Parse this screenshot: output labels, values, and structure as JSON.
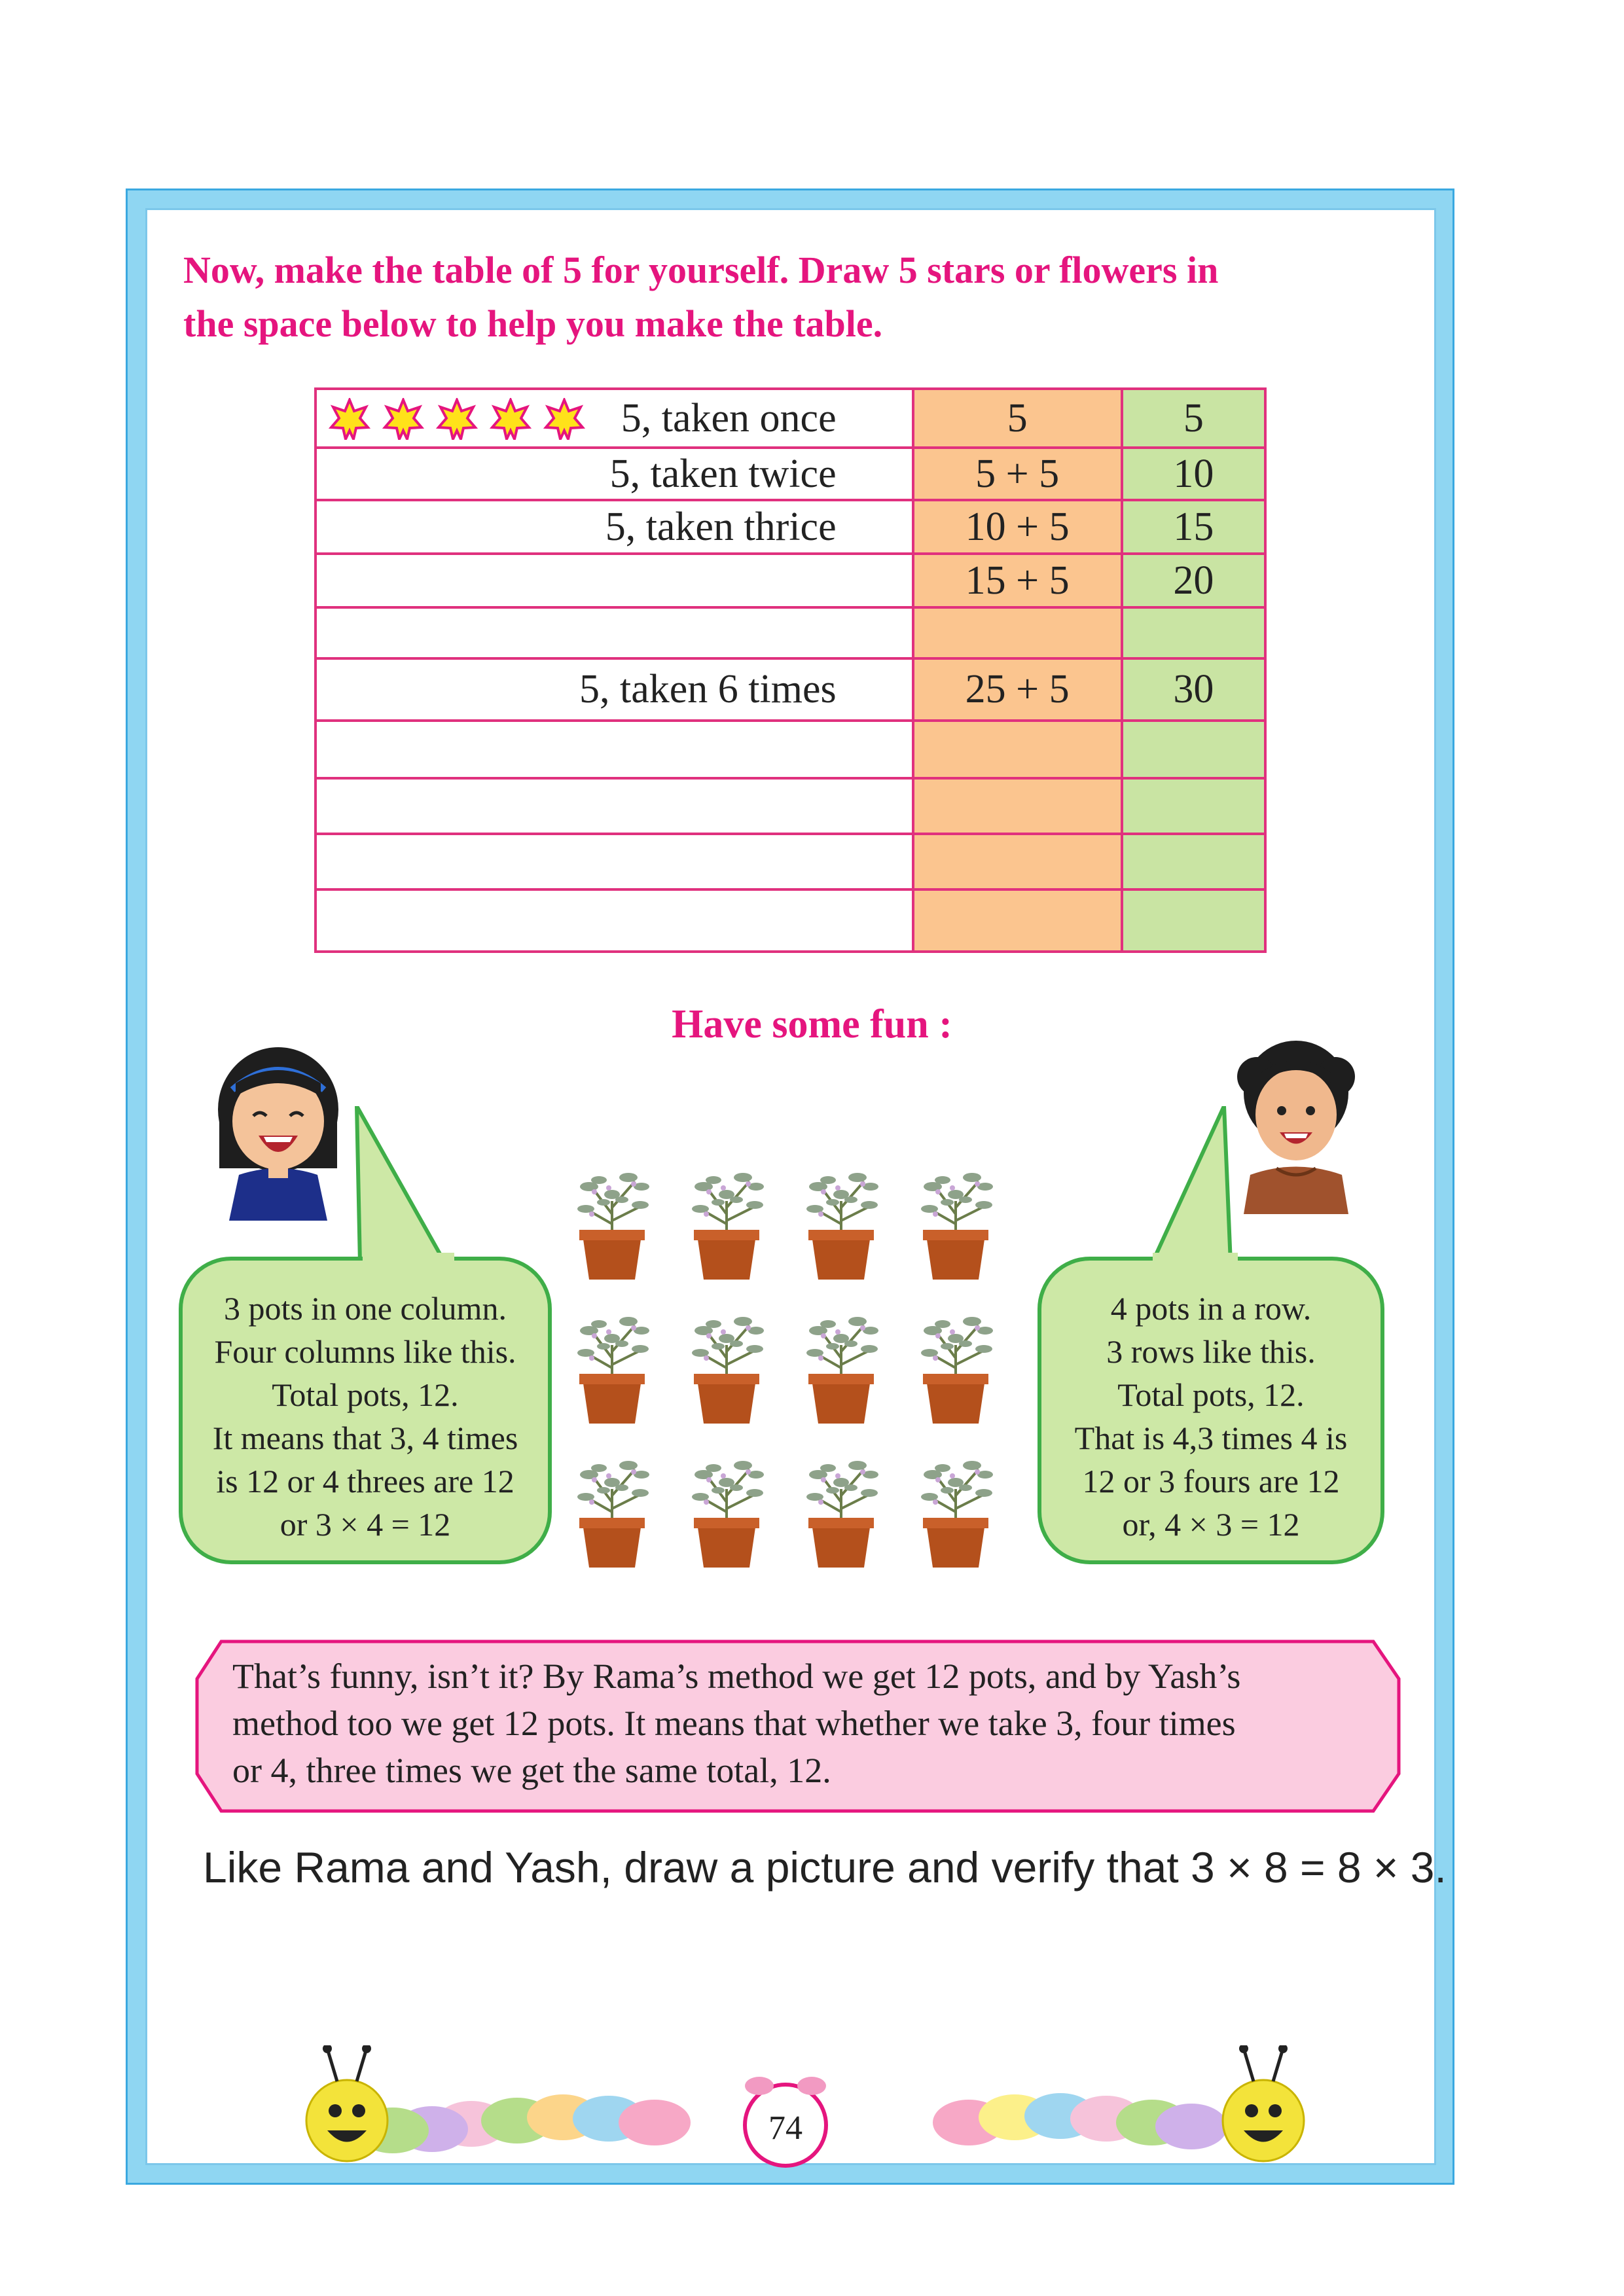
{
  "heading": {
    "line1": "Now, make the table of 5 for yourself. Draw 5 stars or flowers in",
    "line2": "the space below to help you make the table."
  },
  "table": {
    "rows": [
      {
        "label": "5, taken once",
        "sum": "5",
        "total": "5",
        "stars": 5
      },
      {
        "label": "5, taken twice",
        "sum": "5 + 5",
        "total": "10"
      },
      {
        "label": "5, taken thrice",
        "sum": "10 + 5",
        "total": "15"
      },
      {
        "label": "",
        "sum": "15 + 5",
        "total": "20"
      },
      {
        "label": "",
        "sum": "",
        "total": ""
      },
      {
        "label": "5, taken 6 times",
        "sum": "25 + 5",
        "total": "30"
      },
      {
        "label": "",
        "sum": "",
        "total": ""
      },
      {
        "label": "",
        "sum": "",
        "total": ""
      },
      {
        "label": "",
        "sum": "",
        "total": ""
      },
      {
        "label": "",
        "sum": "",
        "total": ""
      }
    ]
  },
  "fun_title": "Have some fun :",
  "left_bubble": {
    "lines": [
      "3 pots in one column.",
      "Four columns like this.",
      "Total pots, 12.",
      "It means that 3, 4 times",
      "is 12 or 4 threes are 12",
      "or 3 × 4 = 12"
    ]
  },
  "right_bubble": {
    "lines": [
      "4 pots in a row.",
      "3 rows like this.",
      "Total pots, 12.",
      "That is 4,3 times 4 is",
      "12 or 3 fours are 12",
      "or, 4 × 3 = 12"
    ]
  },
  "pots": {
    "rows": 3,
    "columns": 4
  },
  "note": {
    "lines": [
      "That’s funny, isn’t it? By Rama’s method we get 12 pots, and by Yash’s",
      "method too we get 12 pots. It means that whether we take 3, four times",
      "or 4, three times we get the same total, 12."
    ]
  },
  "verify_text": "Like Rama and Yash, draw a picture and verify that 3 × 8 = 8 × 3.",
  "page_number": "74",
  "colors": {
    "heading": "#e5157e",
    "sum_column": "#fbc58f",
    "total_column": "#c9e4a3",
    "bubble": "#cde8a6",
    "note": "#fbcce0",
    "frame": "#8fd6f2"
  }
}
